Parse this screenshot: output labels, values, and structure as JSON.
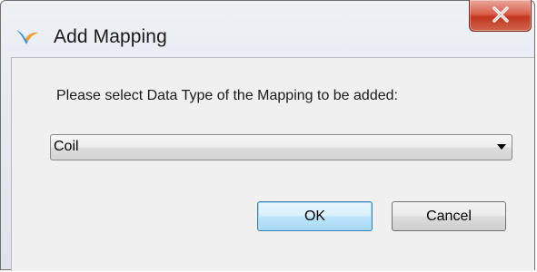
{
  "window": {
    "title": "Add Mapping",
    "close_label": "X"
  },
  "dialog": {
    "prompt": "Please select Data Type of the Mapping to be added:",
    "data_type_select": {
      "selected": "Coil"
    },
    "ok_label": "OK",
    "cancel_label": "Cancel"
  },
  "icons": {
    "app": "bird-logo-icon",
    "close": "close-x-icon",
    "dropdown": "dropdown-arrow-icon"
  },
  "colors": {
    "close_button": "#c1361f",
    "default_button_border": "#3c7fb1",
    "window_frame": "#707070"
  }
}
